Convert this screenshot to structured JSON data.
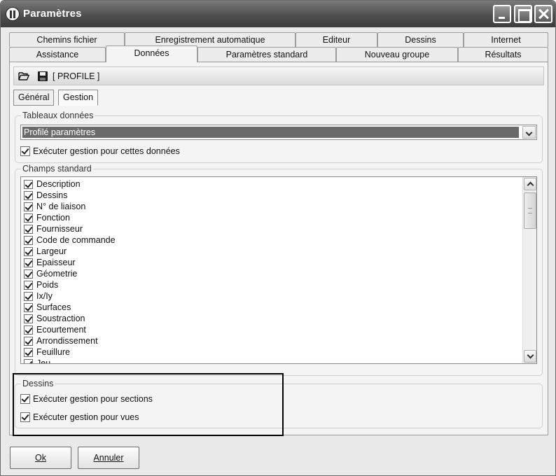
{
  "window": {
    "title": "Paramètres"
  },
  "tabs_row1": [
    "Chemins fichier",
    "Enregistrement automatique",
    "Editeur",
    "Dessins",
    "Internet"
  ],
  "tabs_row2": [
    "Assistance",
    "Données",
    "Paramètres standard",
    "Nouveau groupe",
    "Résultats"
  ],
  "active_tab": "Données",
  "toolbar": {
    "open_icon": "folder-open-icon",
    "save_icon": "save-icon",
    "profile_label": "[ PROFILE ]"
  },
  "subtabs": {
    "general": "Général",
    "gestion": "Gestion",
    "active": "Gestion"
  },
  "tableaux": {
    "legend": "Tableaux données",
    "select_value": "Profilé paramètres",
    "manage_label": "Exécuter gestion pour cettes données",
    "manage_checked": true
  },
  "champs": {
    "legend": "Champs standard",
    "items": [
      {
        "label": "Description",
        "checked": true
      },
      {
        "label": "Dessins",
        "checked": true
      },
      {
        "label": "N° de liaison",
        "checked": true
      },
      {
        "label": "Fonction",
        "checked": true
      },
      {
        "label": "Fournisseur",
        "checked": true
      },
      {
        "label": "Code de commande",
        "checked": true
      },
      {
        "label": "Largeur",
        "checked": true
      },
      {
        "label": "Epaisseur",
        "checked": true
      },
      {
        "label": "Géometrie",
        "checked": true
      },
      {
        "label": "Poids",
        "checked": true
      },
      {
        "label": "Ix/Iy",
        "checked": true
      },
      {
        "label": "Surfaces",
        "checked": true
      },
      {
        "label": "Soustraction",
        "checked": true
      },
      {
        "label": "Ecourtement",
        "checked": true
      },
      {
        "label": "Arrondissement",
        "checked": true
      },
      {
        "label": "Feuillure",
        "checked": true
      },
      {
        "label": "Jeu",
        "checked": true
      }
    ]
  },
  "dessins": {
    "legend": "Dessins",
    "sections_label": "Exécuter gestion pour sections",
    "sections_checked": true,
    "vues_label": "Exécuter gestion pour vues",
    "vues_checked": true
  },
  "buttons": {
    "ok": "Ok",
    "annuler": "Annuler"
  },
  "colors": {
    "title_bar": "#4f4f4f",
    "selection": "#6a6a6a",
    "window_bg": "#e9e9e9"
  }
}
